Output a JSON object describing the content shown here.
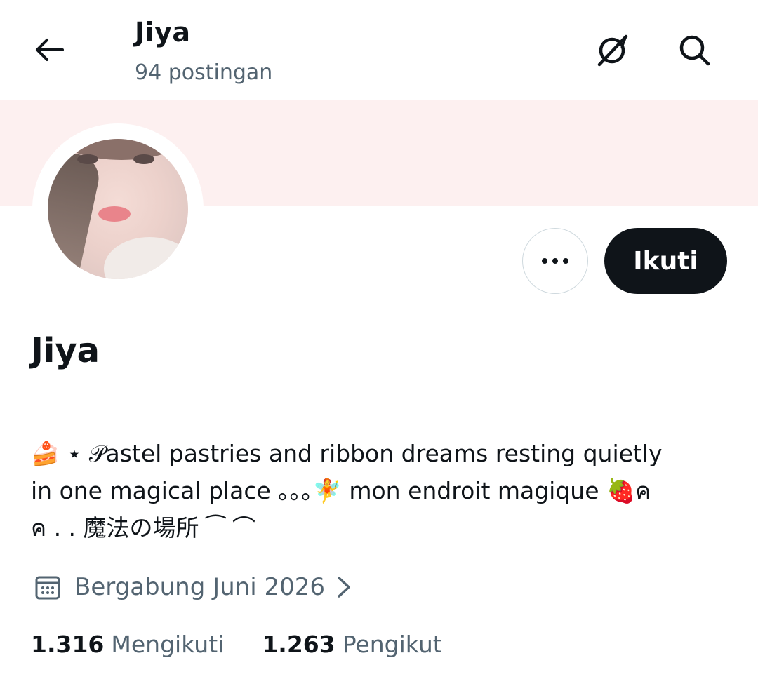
{
  "header": {
    "title": "Jiya",
    "subtitle": "94 postingan",
    "icons": [
      "back-arrow-icon",
      "grok-icon",
      "search-icon"
    ]
  },
  "profile": {
    "name": "Jiya",
    "follow_label": "Ikuti",
    "more_icon": "more-dots-icon",
    "banner_color": "#fdf0f0",
    "bio": {
      "line1": "🍰 ⋆ 𝒫astel pastries and ribbon dreams resting quietly",
      "line2": "in one magical place ｡｡｡🧚 mon endroit magique 🍓ค",
      "line3": "ค . . 魔法の場所    ⁀     ⌒"
    },
    "joined": "Bergabung Juni 2026",
    "joined_icon": "calendar-icon"
  },
  "stats": {
    "following_count": "1.316",
    "following_label": "Mengikuti",
    "followers_count": "1.263",
    "followers_label": "Pengikut"
  },
  "colors": {
    "text": "#0f1419",
    "secondary": "#536471",
    "button_dark": "#0f1419",
    "border": "#cfd9de"
  }
}
